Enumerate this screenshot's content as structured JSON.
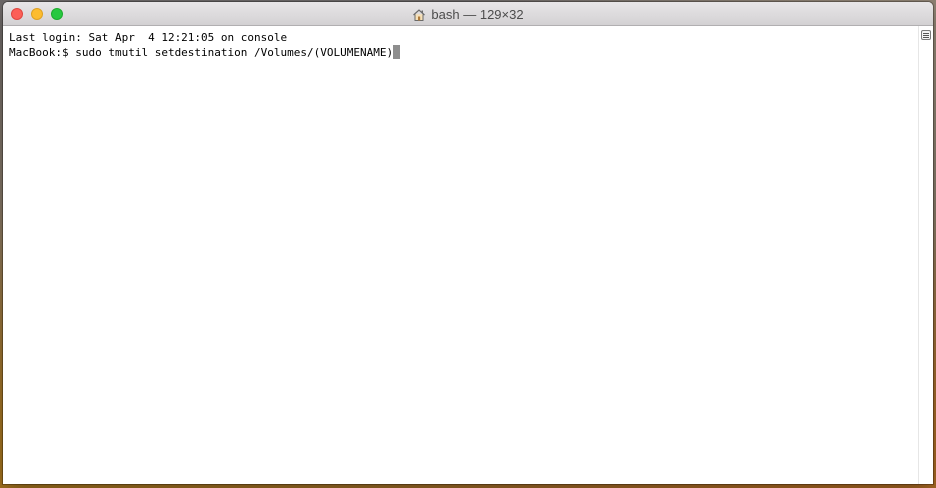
{
  "window": {
    "title": "bash — 129×32",
    "title_icon": "home-icon"
  },
  "terminal": {
    "lines": [
      "Last login: Sat Apr  4 12:21:05 on console",
      "MacBook:$ sudo tmutil setdestination /Volumes/(VOLUMENAME)"
    ],
    "cursor_color": "#8e8e8e"
  },
  "colors": {
    "close": "#fc5f57",
    "minimize": "#fdbc2e",
    "maximize": "#28c840"
  }
}
